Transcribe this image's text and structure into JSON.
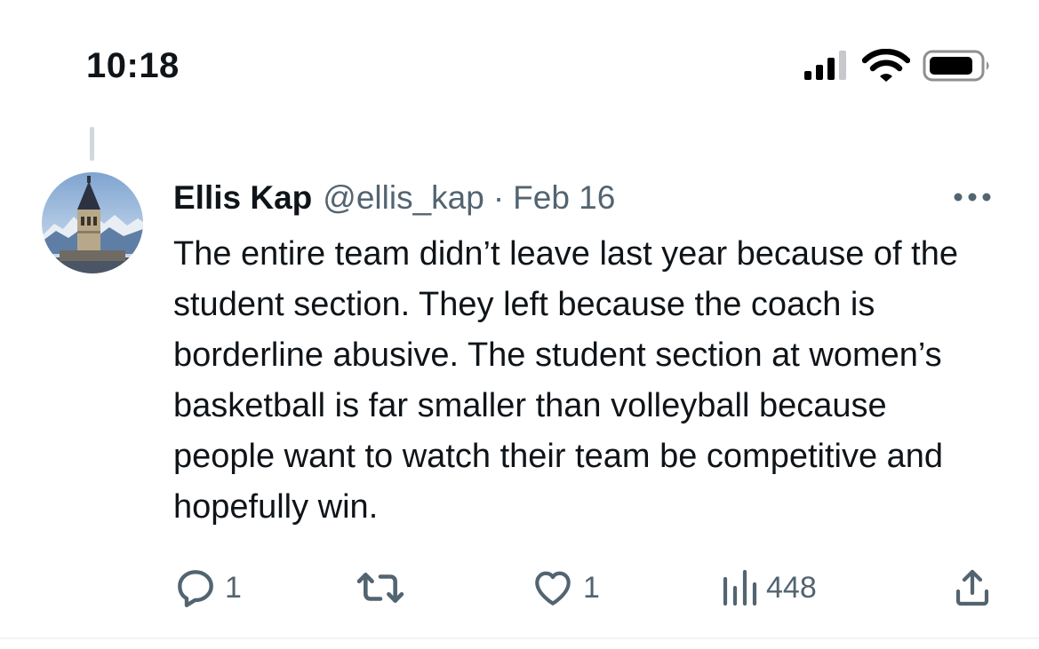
{
  "status_bar": {
    "time": "10:18",
    "icons": [
      "signal-icon",
      "wifi-icon",
      "battery-icon"
    ]
  },
  "tweet": {
    "author": {
      "display_name": "Ellis Kap",
      "handle": "@ellis_kap"
    },
    "separator": "·",
    "date": "Feb 16",
    "text": "The entire team didn’t leave last year because of the student section. They left because the coach is borderline abusive. The student section at women’s basketball is far smaller than volleyball because people want to watch their team be competitive and hopefully win.",
    "actions": {
      "reply_count": "1",
      "retweet_count": "",
      "like_count": "1",
      "view_count": "448"
    }
  },
  "colors": {
    "text_primary": "#0f1419",
    "text_secondary": "#536471",
    "thread_line": "#cfd9de",
    "divider": "#eff3f4"
  }
}
